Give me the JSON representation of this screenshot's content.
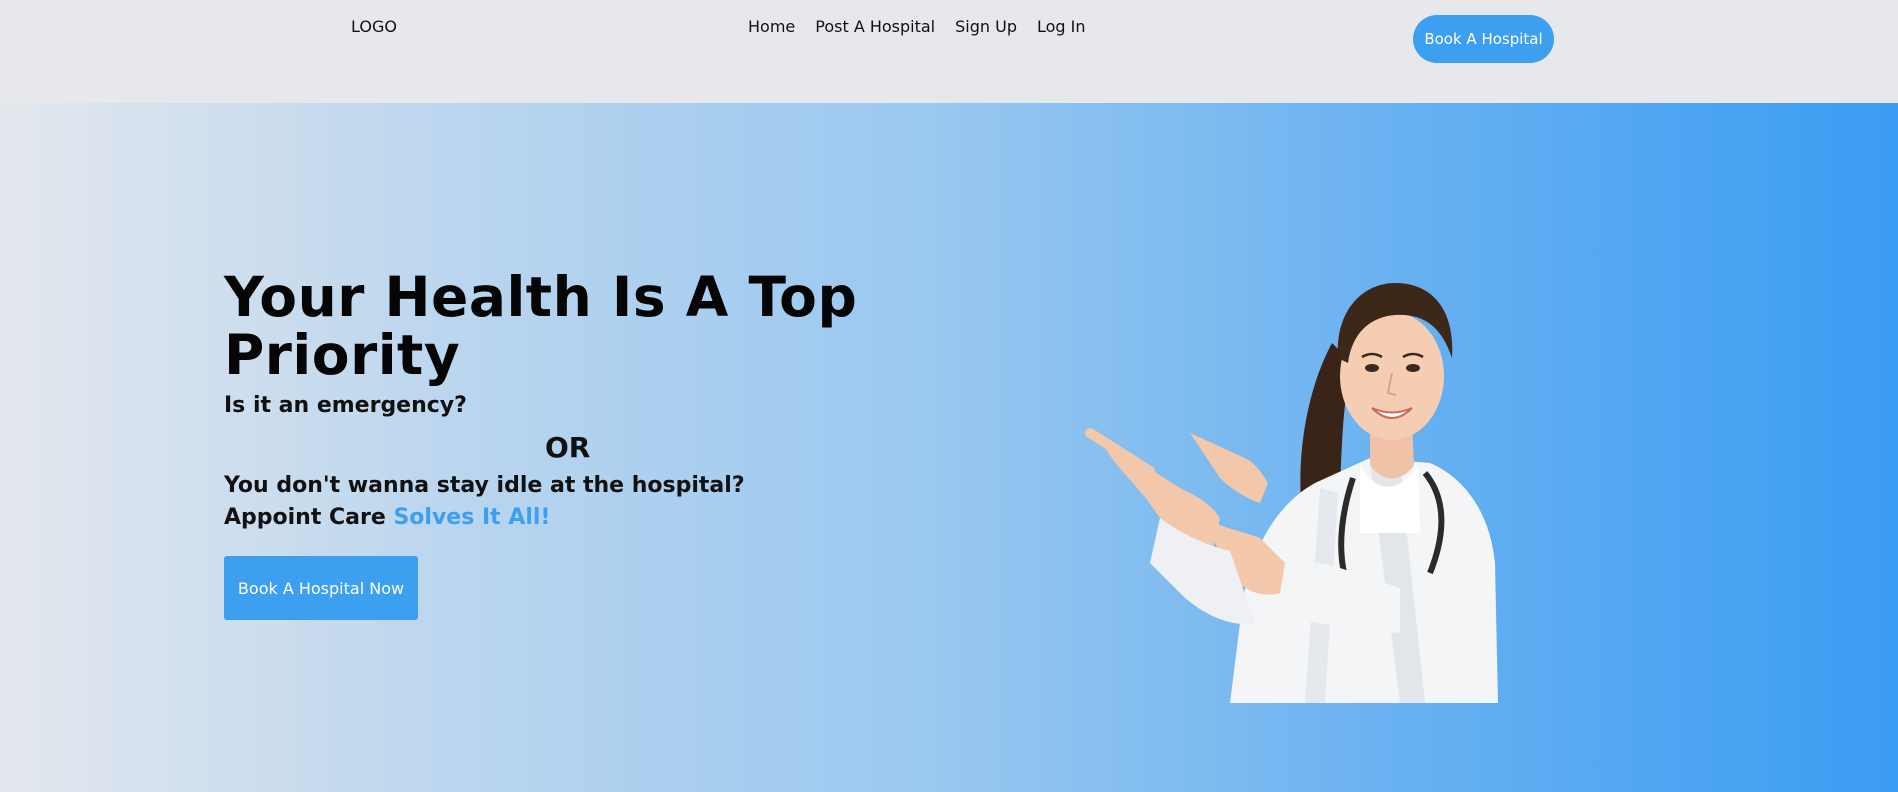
{
  "header": {
    "logo": "LOGO",
    "nav": [
      "Home",
      "Post A Hospital",
      "Sign Up",
      "Log In"
    ],
    "cta_label": "Book A Hospital"
  },
  "hero": {
    "headline": "Your Health Is A Top Priority",
    "line1": "Is it an emergency?",
    "or": "OR",
    "line2": "You don't wanna stay idle at the hospital?",
    "line3_prefix": "Appoint Care ",
    "line3_accent": "Solves It All!",
    "cta_label": "Book A Hospital Now"
  },
  "colors": {
    "accent": "#3d9ff0",
    "header_bg": "#e6e8ec",
    "gradient_end": "#3a9cf2"
  },
  "icons": {
    "hero_image": "doctor-pointing-illustration"
  }
}
